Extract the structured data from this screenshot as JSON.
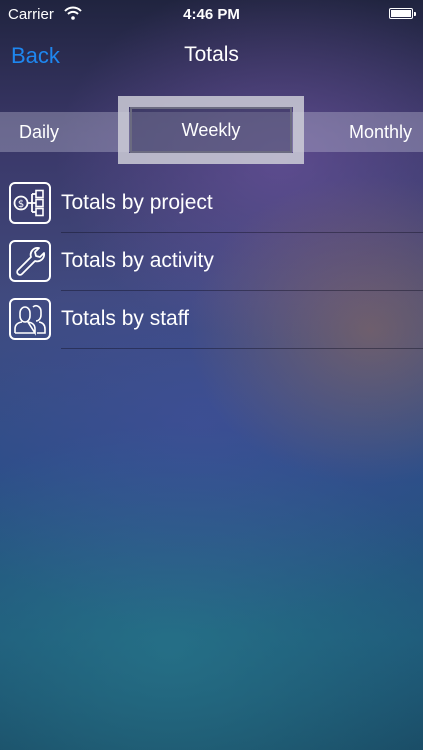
{
  "status_bar": {
    "carrier": "Carrier",
    "time": "4:46 PM",
    "icons": [
      "wifi-icon",
      "battery-icon"
    ]
  },
  "nav": {
    "back_label": "Back",
    "title": "Totals",
    "accent_color": "#1e87f0"
  },
  "segments": {
    "items": [
      "Daily",
      "Weekly",
      "Monthly"
    ],
    "selected": "Weekly"
  },
  "list": {
    "items": [
      {
        "label": "Totals by project",
        "icon": "project-hierarchy-icon"
      },
      {
        "label": "Totals by activity",
        "icon": "wrench-icon"
      },
      {
        "label": "Totals by staff",
        "icon": "staff-people-icon"
      }
    ]
  }
}
